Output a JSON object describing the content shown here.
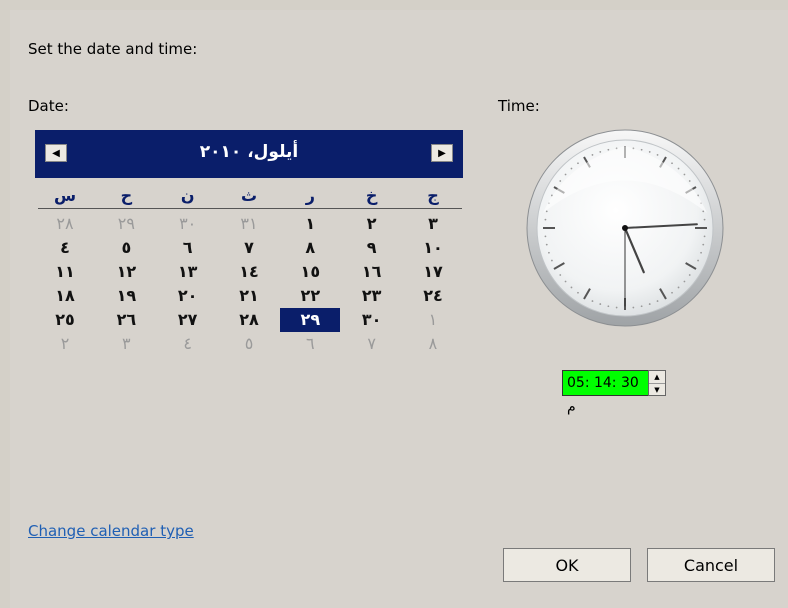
{
  "dialog": {
    "heading": "Set the date and time:",
    "date_label": "Date:",
    "time_label": "Time:",
    "change_calendar_link": "Change calendar type",
    "ok_label": "OK",
    "cancel_label": "Cancel"
  },
  "calendar": {
    "month_title": "أيلول، ٢٠١٠",
    "prev_icon": "◀",
    "next_icon": "▶",
    "weekdays": [
      "س",
      "ح",
      "ن",
      "ث",
      "ر",
      "خ",
      "ج"
    ],
    "weeks": [
      [
        {
          "t": "٢٨",
          "s": "other"
        },
        {
          "t": "٢٩",
          "s": "other"
        },
        {
          "t": "٣٠",
          "s": "other"
        },
        {
          "t": "٣١",
          "s": "other"
        },
        {
          "t": "١",
          "s": "cur"
        },
        {
          "t": "٢",
          "s": "cur"
        },
        {
          "t": "٣",
          "s": "cur"
        }
      ],
      [
        {
          "t": "٤",
          "s": "cur"
        },
        {
          "t": "٥",
          "s": "cur"
        },
        {
          "t": "٦",
          "s": "cur"
        },
        {
          "t": "٧",
          "s": "cur"
        },
        {
          "t": "٨",
          "s": "cur"
        },
        {
          "t": "٩",
          "s": "cur"
        },
        {
          "t": "١٠",
          "s": "cur"
        }
      ],
      [
        {
          "t": "١١",
          "s": "cur"
        },
        {
          "t": "١٢",
          "s": "cur"
        },
        {
          "t": "١٣",
          "s": "cur"
        },
        {
          "t": "١٤",
          "s": "cur"
        },
        {
          "t": "١٥",
          "s": "cur"
        },
        {
          "t": "١٦",
          "s": "cur"
        },
        {
          "t": "١٧",
          "s": "cur"
        }
      ],
      [
        {
          "t": "١٨",
          "s": "cur"
        },
        {
          "t": "١٩",
          "s": "cur"
        },
        {
          "t": "٢٠",
          "s": "cur"
        },
        {
          "t": "٢١",
          "s": "cur"
        },
        {
          "t": "٢٢",
          "s": "cur"
        },
        {
          "t": "٢٣",
          "s": "cur"
        },
        {
          "t": "٢٤",
          "s": "cur"
        }
      ],
      [
        {
          "t": "٢٥",
          "s": "cur"
        },
        {
          "t": "٢٦",
          "s": "cur"
        },
        {
          "t": "٢٧",
          "s": "cur"
        },
        {
          "t": "٢٨",
          "s": "cur"
        },
        {
          "t": "٢٩",
          "s": "sel"
        },
        {
          "t": "٣٠",
          "s": "cur"
        },
        {
          "t": "١",
          "s": "other"
        }
      ],
      [
        {
          "t": "٢",
          "s": "other"
        },
        {
          "t": "٣",
          "s": "other"
        },
        {
          "t": "٤",
          "s": "other"
        },
        {
          "t": "٥",
          "s": "other"
        },
        {
          "t": "٦",
          "s": "other"
        },
        {
          "t": "٧",
          "s": "other"
        },
        {
          "t": "٨",
          "s": "other"
        }
      ]
    ]
  },
  "time": {
    "value": "05: 14: 30 م",
    "hour": 5,
    "minute": 14,
    "second": 30,
    "field_color": "#00ff00"
  },
  "colors": {
    "header_bg": "#0a1e6a",
    "link": "#1f5fb4"
  }
}
